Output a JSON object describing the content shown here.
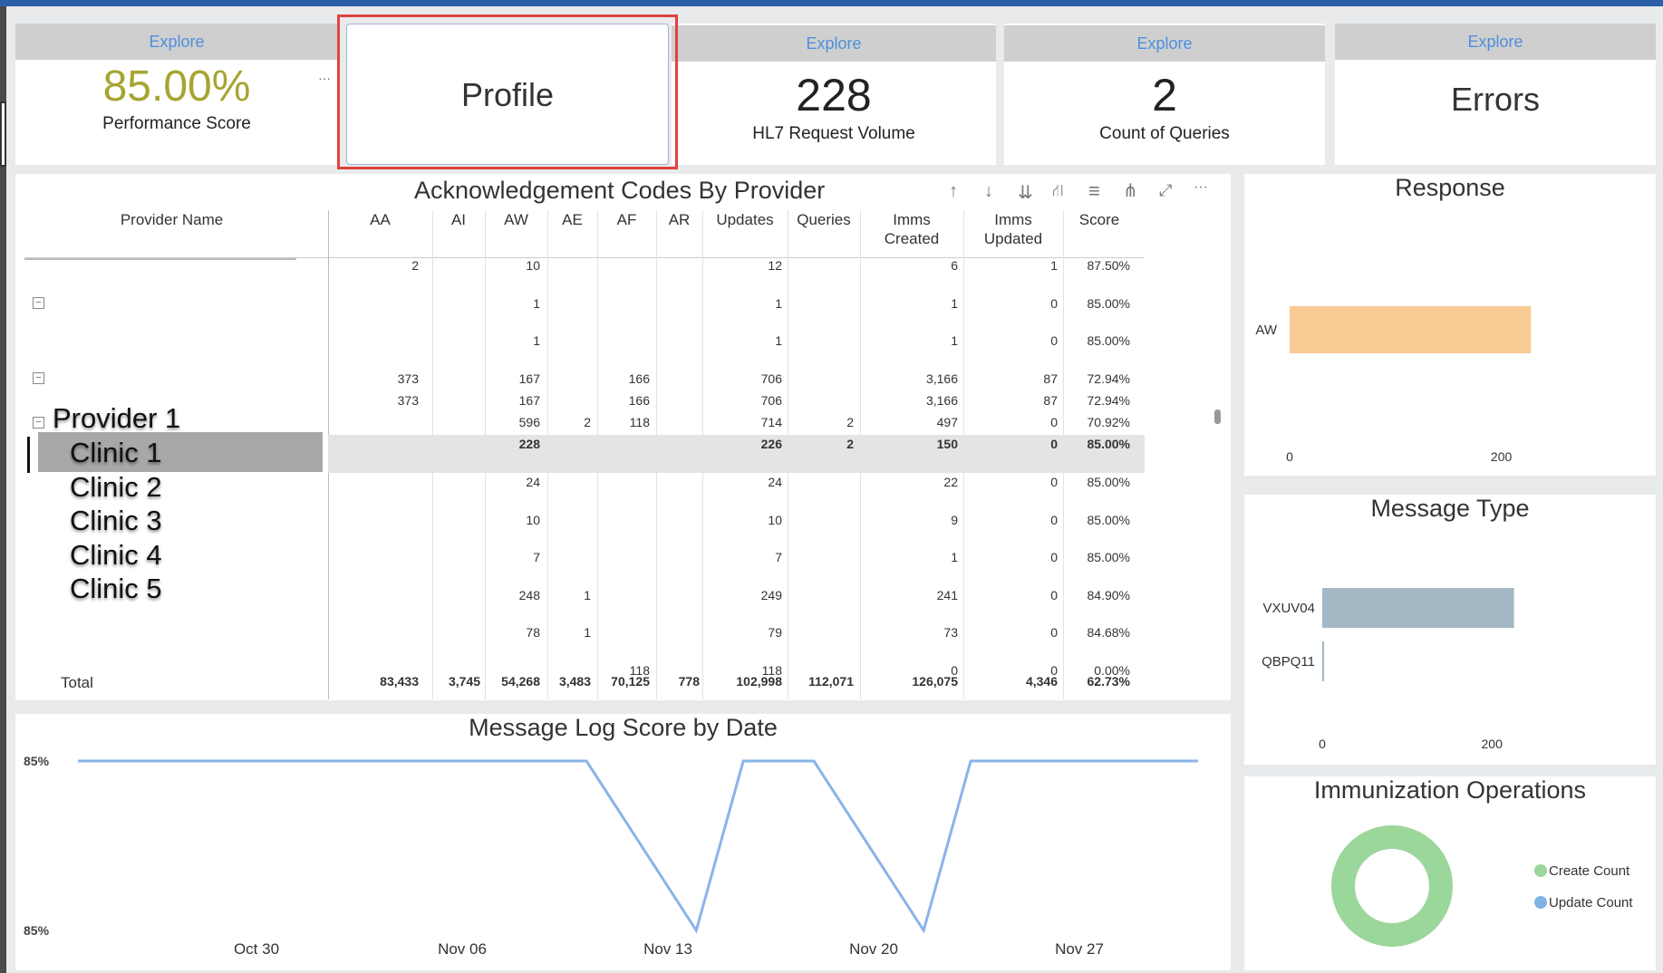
{
  "kpis": {
    "performance": {
      "explore": "Explore",
      "value": "85.00%",
      "label": "Performance Score",
      "more": "···"
    },
    "profile": {
      "label": "Profile"
    },
    "hl7": {
      "explore": "Explore",
      "value": "228",
      "label": "HL7 Request Volume"
    },
    "queries": {
      "explore": "Explore",
      "value": "2",
      "label": "Count of Queries"
    },
    "errors": {
      "explore": "Explore",
      "label": "Errors"
    }
  },
  "ack_table": {
    "title": "Acknowledgement Codes By Provider",
    "toolbar": {
      "up": "↑",
      "down": "↓",
      "expand_all": "⇊",
      "hierarchy": "⛙",
      "filter": "≡",
      "focus": "⋔",
      "popout": "⤢",
      "more": "···"
    },
    "columns": [
      "Provider Name",
      "AA",
      "AI",
      "AW",
      "AE",
      "AF",
      "AR",
      "Updates",
      "Queries",
      "Imms",
      "Imms",
      "Score"
    ],
    "columns_line2": {
      "imms_created": "Created",
      "imms_updated": "Updated"
    },
    "rows": [
      [
        "2",
        "",
        "10",
        "",
        "",
        "",
        "12",
        "",
        "6",
        "1",
        "87.50%"
      ],
      [
        "",
        "",
        "1",
        "",
        "",
        "",
        "1",
        "",
        "1",
        "0",
        "85.00%"
      ],
      [
        "",
        "",
        "1",
        "",
        "",
        "",
        "1",
        "",
        "1",
        "0",
        "85.00%"
      ],
      [
        "373",
        "",
        "167",
        "",
        "166",
        "",
        "706",
        "",
        "3,166",
        "87",
        "72.94%"
      ],
      [
        "373",
        "",
        "167",
        "",
        "166",
        "",
        "706",
        "",
        "3,166",
        "87",
        "72.94%"
      ],
      [
        "",
        "",
        "596",
        "2",
        "118",
        "",
        "714",
        "2",
        "497",
        "0",
        "70.92%"
      ],
      [
        "",
        "",
        "228",
        "",
        "",
        "",
        "226",
        "2",
        "150",
        "0",
        "85.00%"
      ],
      [
        "",
        "",
        "24",
        "",
        "",
        "",
        "24",
        "",
        "22",
        "0",
        "85.00%"
      ],
      [
        "",
        "",
        "10",
        "",
        "",
        "",
        "10",
        "",
        "9",
        "0",
        "85.00%"
      ],
      [
        "",
        "",
        "7",
        "",
        "",
        "",
        "7",
        "",
        "1",
        "0",
        "85.00%"
      ],
      [
        "",
        "",
        "248",
        "1",
        "",
        "",
        "249",
        "",
        "241",
        "0",
        "84.90%"
      ],
      [
        "",
        "",
        "78",
        "1",
        "",
        "",
        "79",
        "",
        "73",
        "0",
        "84.68%"
      ],
      [
        "",
        "",
        "",
        "",
        "118",
        "",
        "118",
        "",
        "0",
        "0",
        "0.00%"
      ]
    ],
    "total": {
      "label": "Total",
      "values": [
        "83,433",
        "3,745",
        "54,268",
        "3,483",
        "70,125",
        "778",
        "102,998",
        "112,071",
        "126,075",
        "4,346",
        "62.73%"
      ]
    },
    "tree_overlay": [
      "Provider 1",
      "Clinic 1",
      "Clinic 2",
      "Clinic 3",
      "Clinic 4",
      "Clinic 5"
    ]
  },
  "response_chart": {
    "title": "Response",
    "chart_data": {
      "type": "bar",
      "orientation": "horizontal",
      "categories": [
        "AW"
      ],
      "values": [
        228
      ],
      "xticks": [
        "0",
        "200"
      ],
      "color": "#f8cb94"
    }
  },
  "message_type_chart": {
    "title": "Message Type",
    "chart_data": {
      "type": "bar",
      "orientation": "horizontal",
      "categories": [
        "VXUV04",
        "QBPQ11"
      ],
      "values": [
        226,
        2
      ],
      "xticks": [
        "0",
        "200"
      ],
      "color": "#a3b8c4"
    }
  },
  "imm_ops_chart": {
    "title": "Immunization Operations",
    "chart_data": {
      "type": "pie",
      "donut": true,
      "series": [
        {
          "name": "Create Count",
          "value": 150,
          "color": "#9bd69b"
        },
        {
          "name": "Update Count",
          "value": 0,
          "color": "#7fb3e8"
        }
      ]
    }
  },
  "log_chart": {
    "title": "Message Log Score by Date",
    "chart_data": {
      "type": "line",
      "y_labels": [
        "85%",
        "85%"
      ],
      "x_ticks": [
        "Oct 30",
        "Nov 06",
        "Nov 13",
        "Nov 20",
        "Nov 27"
      ],
      "color": "#8ab4e8",
      "points": [
        [
          0,
          1
        ],
        [
          0.454,
          1
        ],
        [
          0.552,
          0
        ],
        [
          0.594,
          1
        ],
        [
          0.657,
          1
        ],
        [
          0.755,
          0
        ],
        [
          0.797,
          1
        ],
        [
          1,
          1
        ]
      ]
    }
  }
}
